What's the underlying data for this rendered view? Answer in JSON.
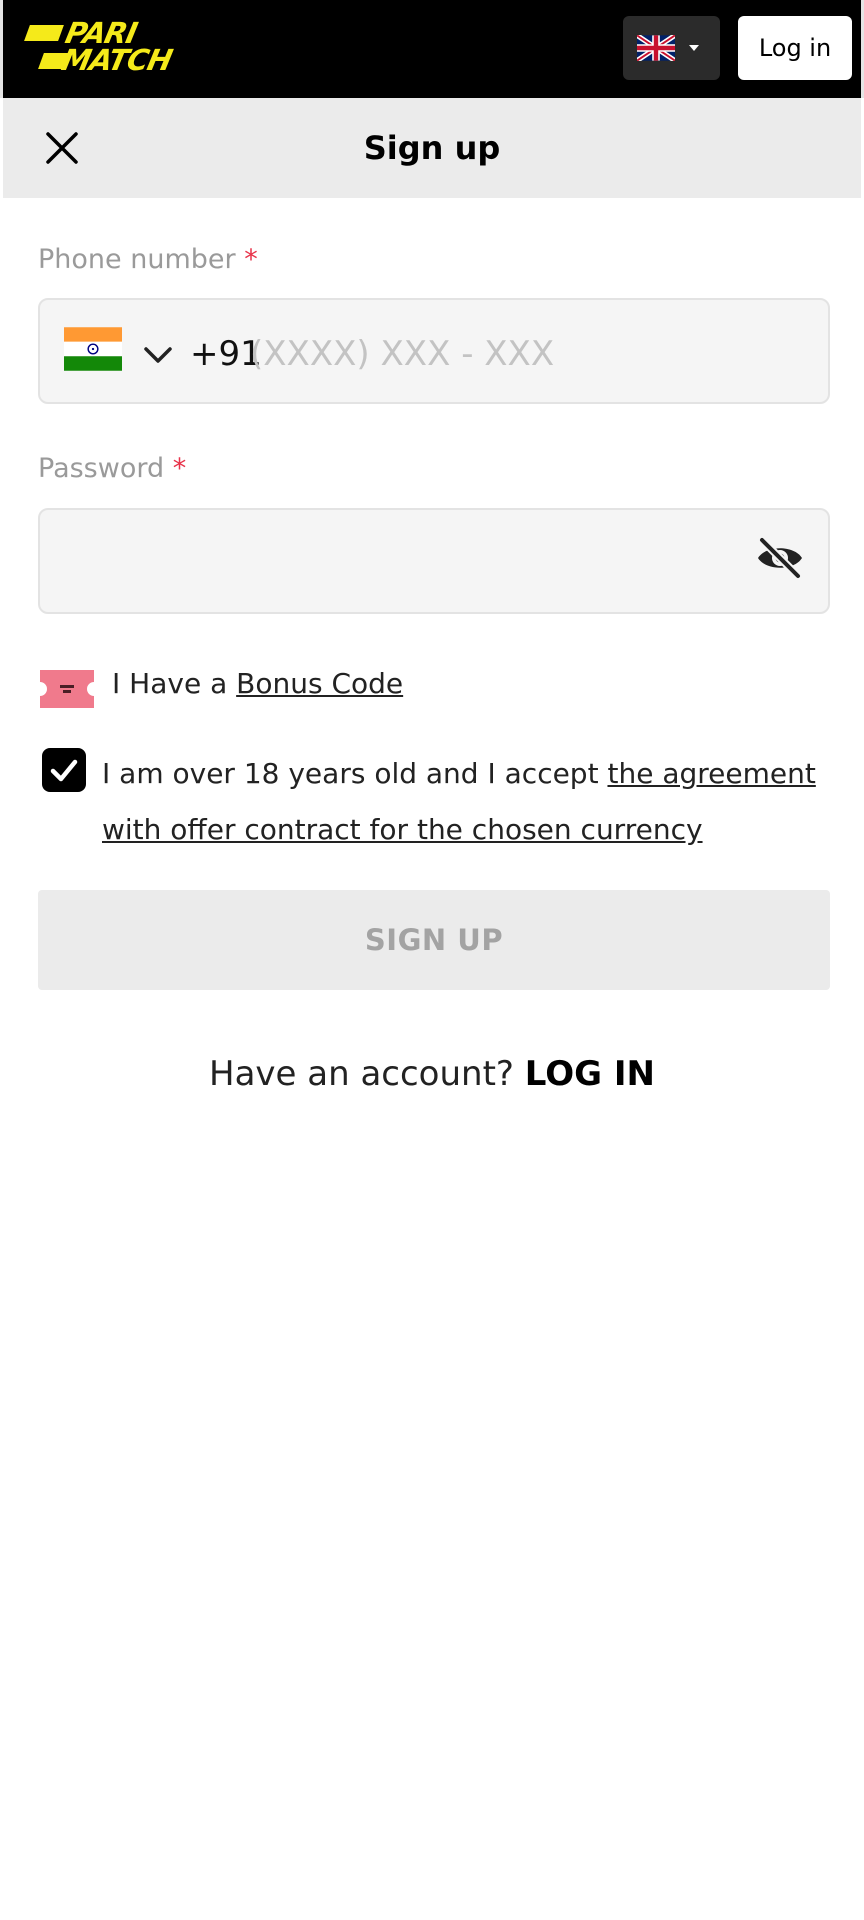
{
  "header": {
    "logo_line1": "PARI",
    "logo_line2": "MATCH",
    "language_icon": "uk-flag-icon",
    "login_label": "Log in",
    "logo_color": "#f5ea1a"
  },
  "signup": {
    "title": "Sign up",
    "close_icon": "close-icon",
    "phone": {
      "label": "Phone number",
      "required_mark": "*",
      "country_icon": "india-flag-icon",
      "prefix": "+91",
      "placeholder": "(XXXX) XXX - XXX",
      "value": ""
    },
    "password": {
      "label": "Password",
      "required_mark": "*",
      "value": "",
      "toggle_icon": "eye-off-icon"
    },
    "bonus": {
      "icon": "ticket-icon",
      "text": "I Have a ",
      "link": "Bonus Code"
    },
    "agreement": {
      "checked": true,
      "text": "I am over 18 years old and I accept ",
      "link": "the agreement with offer contract for the chosen currency"
    },
    "submit_label": "SIGN UP",
    "footer": {
      "question": "Have an account?",
      "login_link": "LOG IN"
    }
  }
}
